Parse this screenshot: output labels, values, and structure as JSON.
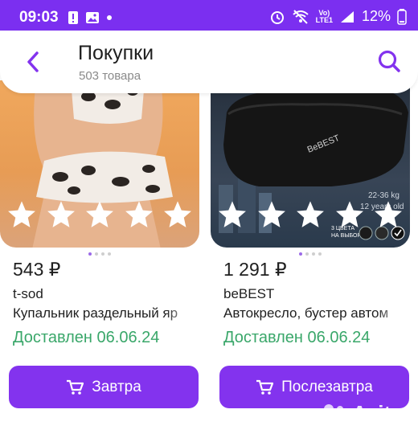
{
  "status": {
    "time": "09:03",
    "network": "LTE1",
    "volte": "Vo)",
    "battery": "12%"
  },
  "header": {
    "title": "Покупки",
    "subtitle": "503 товара"
  },
  "products": [
    {
      "price": "543 ₽",
      "seller": "t-sod",
      "name": "Купальник раздельный яр",
      "delivery": "Доставлен 06.06.24",
      "button": "Завтра",
      "image": "leopard-print swimsuit",
      "rating_stars": 5
    },
    {
      "price": "1 291 ₽",
      "seller": "beBEST",
      "name": "Автокресло, бустер автом",
      "delivery": "Доставлен 06.06.24",
      "button": "Послезавтра",
      "image": "black car booster seat",
      "image_text": {
        "brand": "BeBEST",
        "weight": "22-36 kg",
        "age": "12 years old",
        "colors_line1": "3 ЦВЕТА",
        "colors_line2": "НА ВЫБОР"
      },
      "rating_stars": 5
    }
  ],
  "watermark": "Avito",
  "colors": {
    "accent": "#8333ee",
    "status_bar": "#7b2ff0",
    "delivered": "#3aa76a"
  }
}
